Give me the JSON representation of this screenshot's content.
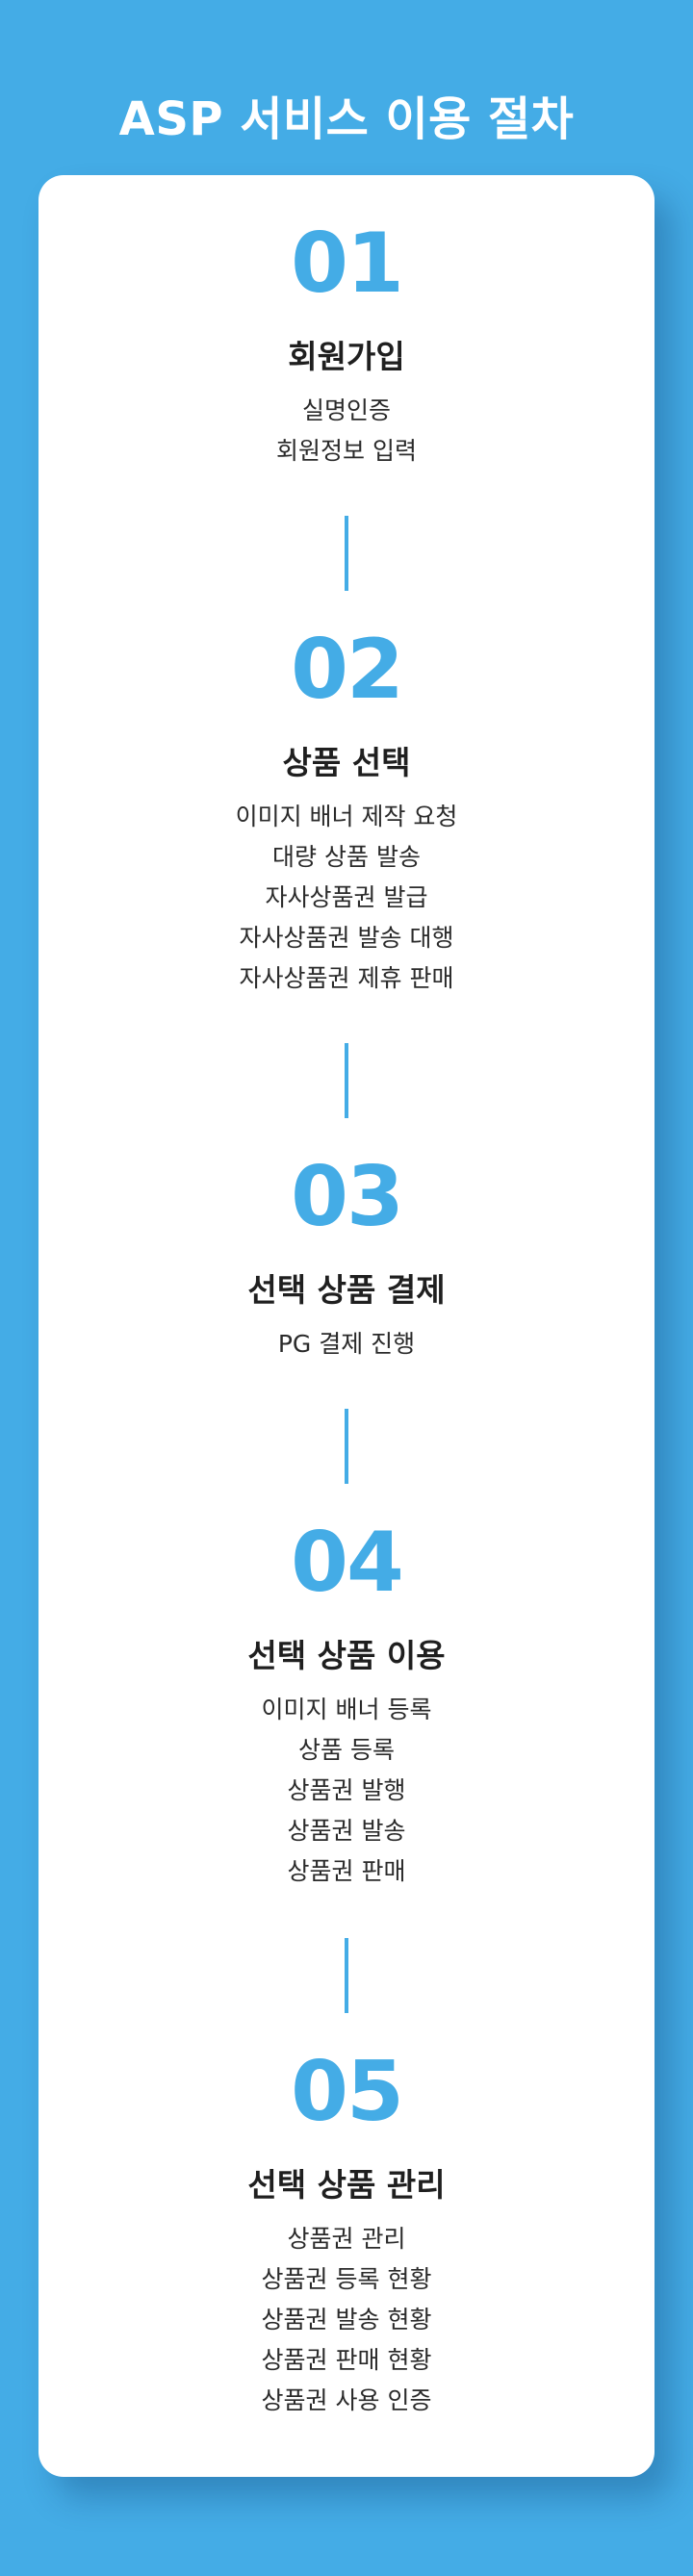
{
  "title": "ASP 서비스 이용 절차",
  "accent_color": "#44ace6",
  "card_color": "#ffffff",
  "steps": [
    {
      "number": "01",
      "heading": "회원가입",
      "items": [
        "실명인증",
        "회원정보 입력"
      ]
    },
    {
      "number": "02",
      "heading": "상품 선택",
      "items": [
        "이미지 배너 제작 요청",
        "대량 상품 발송",
        "자사상품권 발급",
        "자사상품권 발송 대행",
        "자사상품권 제휴 판매"
      ]
    },
    {
      "number": "03",
      "heading": "선택 상품 결제",
      "items": [
        "PG 결제 진행"
      ]
    },
    {
      "number": "04",
      "heading": "선택 상품 이용",
      "items": [
        "이미지 배너 등록",
        "상품 등록",
        "상품권 발행",
        "상품권 발송",
        "상품권 판매"
      ]
    },
    {
      "number": "05",
      "heading": "선택 상품 관리",
      "items": [
        "상품권 관리",
        "상품권 등록 현황",
        "상품권 발송 현황",
        "상품권 판매 현황",
        "상품권 사용 인증"
      ]
    }
  ]
}
